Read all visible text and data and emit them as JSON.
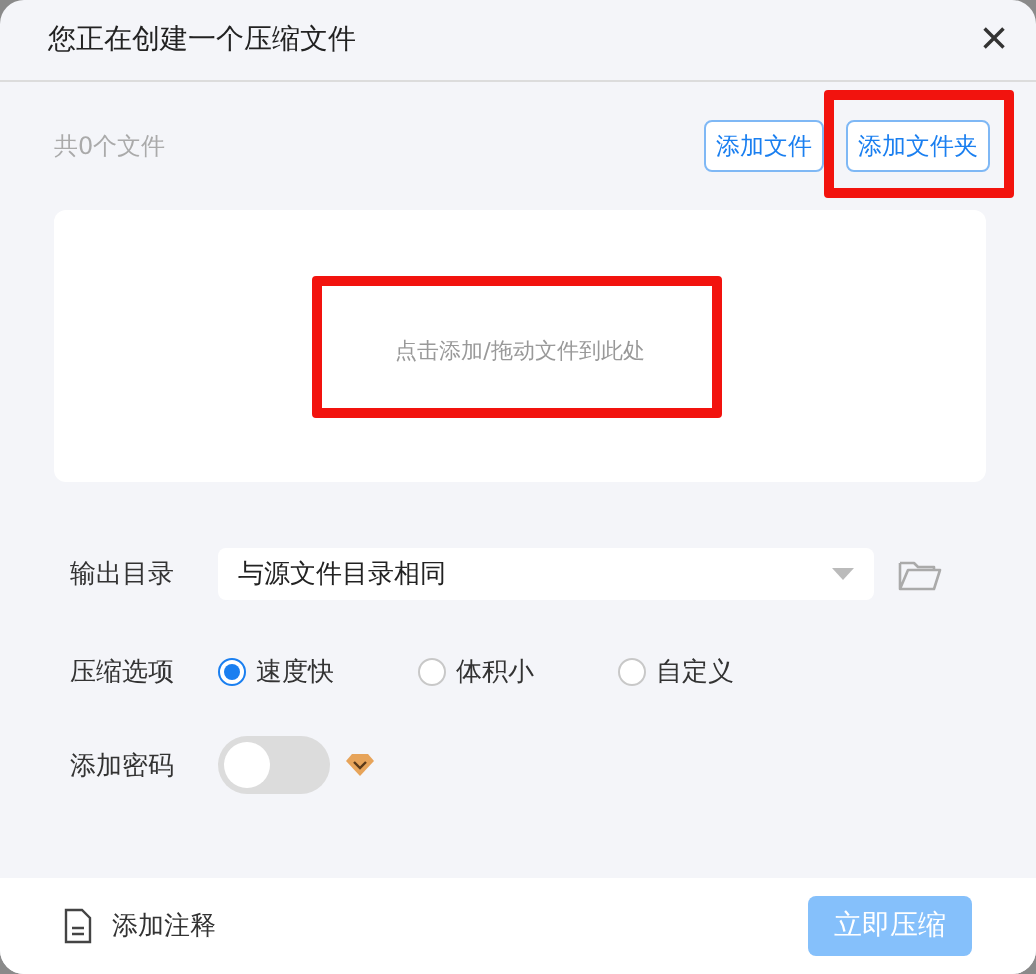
{
  "window": {
    "title": "您正在创建一个压缩文件",
    "close": "×"
  },
  "files": {
    "count": "共0个文件",
    "buttons": [
      {
        "label": "添加文件",
        "highlighted": false
      },
      {
        "label": "添加文件夹",
        "highlighted": true
      }
    ],
    "drop_hint": "点击添加/拖动文件到此处",
    "drop_hint_highlighted": true
  },
  "output": {
    "label": "输出目录",
    "value": "与源文件目录相同"
  },
  "compression": {
    "label": "压缩选项",
    "options": [
      {
        "label": "速度快",
        "selected": true
      },
      {
        "label": "体积小",
        "selected": false
      },
      {
        "label": "自定义",
        "selected": false
      }
    ]
  },
  "password": {
    "label": "添加密码",
    "on": false
  },
  "footer": {
    "comment": "添加注释",
    "submit": {
      "label": "立即压缩",
      "disabled": true
    }
  }
}
